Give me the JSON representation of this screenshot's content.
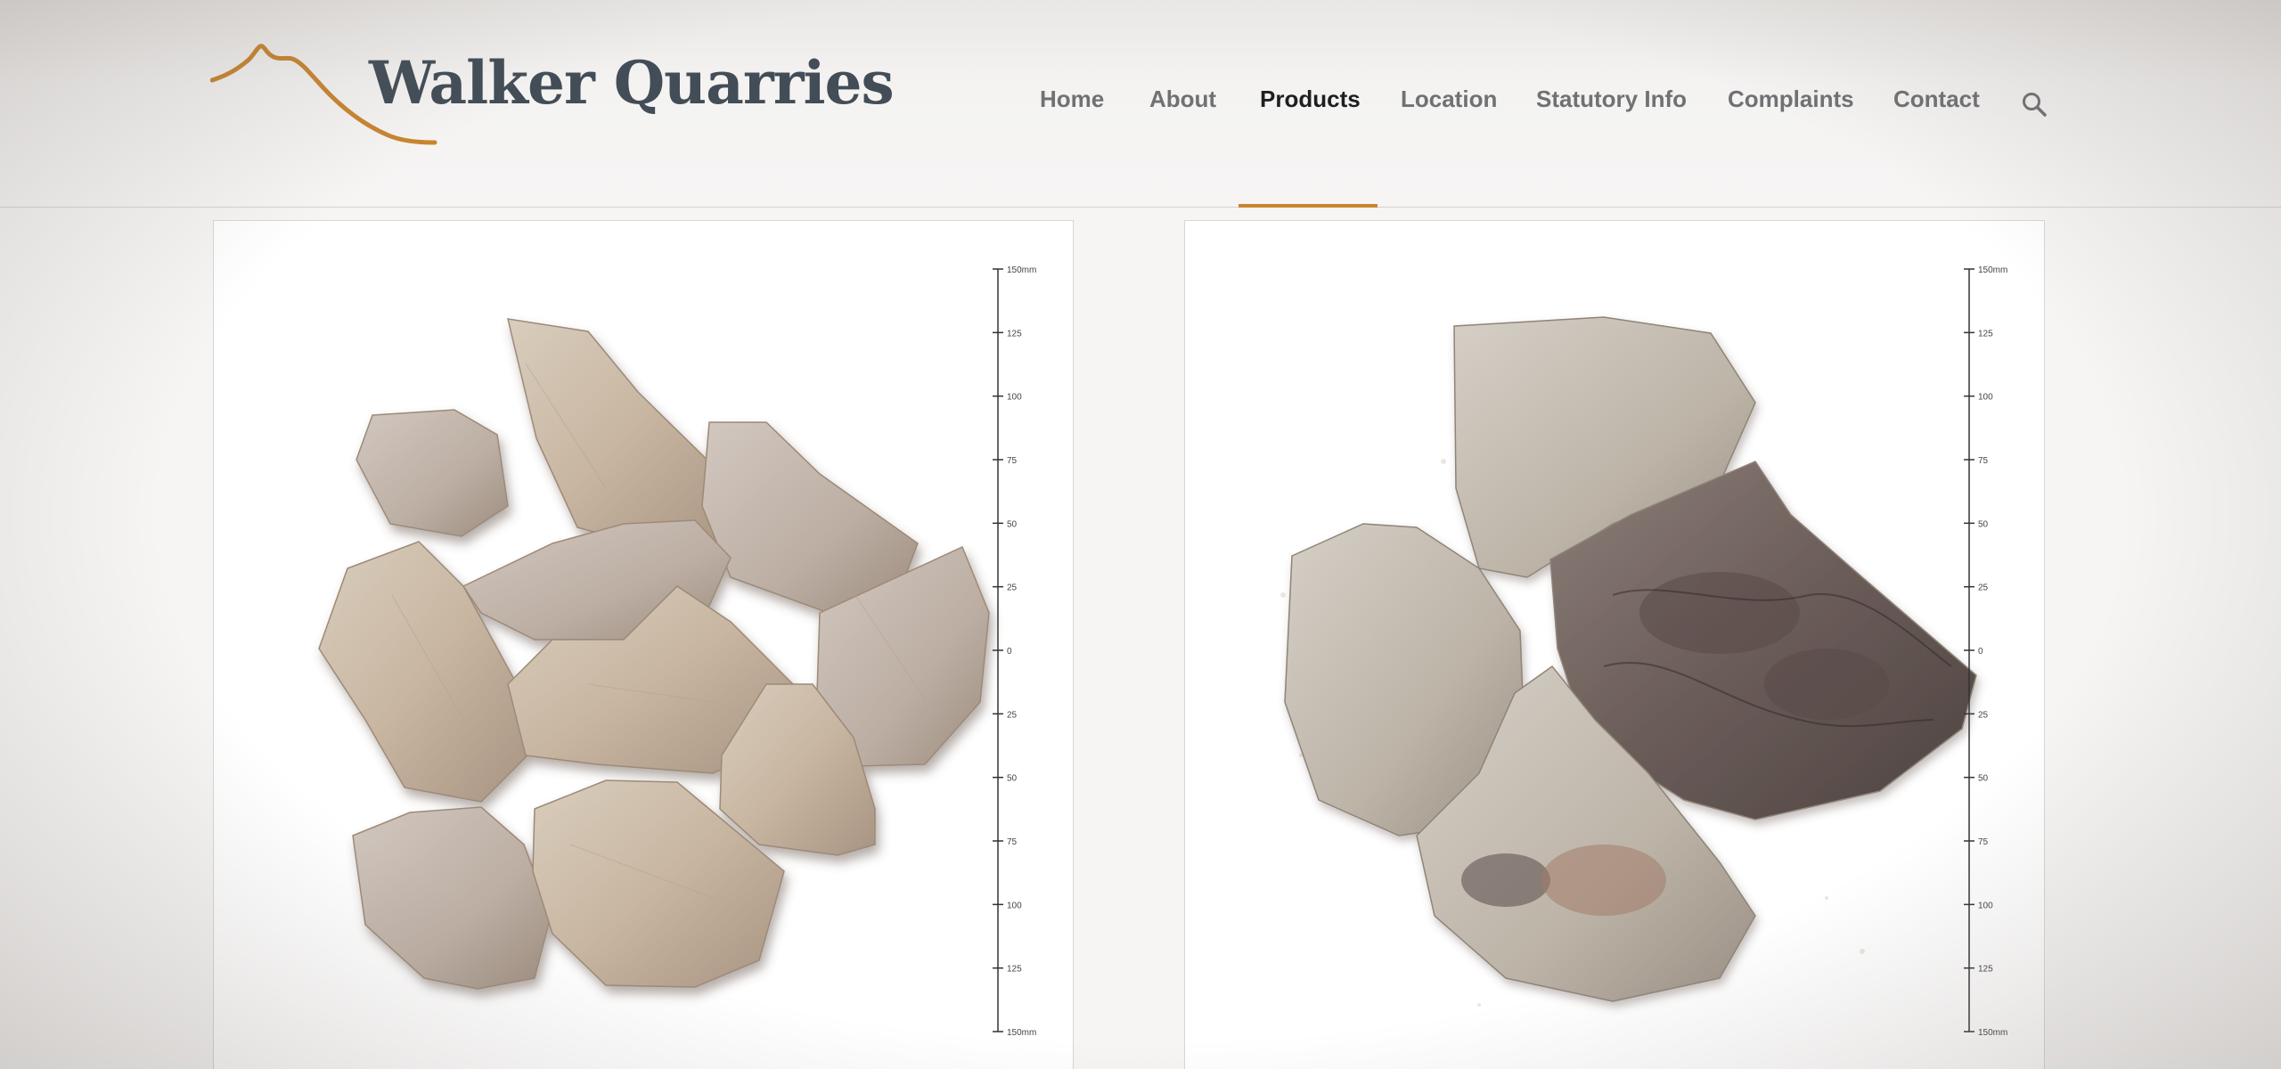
{
  "brand": {
    "name": "Walker Quarries",
    "logo_accent": "#c8852f",
    "text_color": "#424d57"
  },
  "nav": {
    "items": [
      {
        "label": "Home",
        "active": false
      },
      {
        "label": "About",
        "active": false
      },
      {
        "label": "Products",
        "active": true
      },
      {
        "label": "Location",
        "active": false
      },
      {
        "label": "Statutory Info",
        "active": false
      },
      {
        "label": "Complaints",
        "active": false
      },
      {
        "label": "Contact",
        "active": false
      }
    ],
    "search_icon": "search-icon",
    "active_underline_color": "#c8852f"
  },
  "products": [
    {
      "image": "light-stone-aggregate",
      "scale_labels": [
        "150mm",
        "125",
        "100",
        "75",
        "50",
        "25",
        "0",
        "25",
        "50",
        "75",
        "100",
        "125",
        "150mm"
      ]
    },
    {
      "image": "dark-veined-stone-aggregate",
      "scale_labels": [
        "150mm",
        "125",
        "100",
        "75",
        "50",
        "25",
        "0",
        "25",
        "50",
        "75",
        "100",
        "125",
        "150mm"
      ]
    }
  ]
}
